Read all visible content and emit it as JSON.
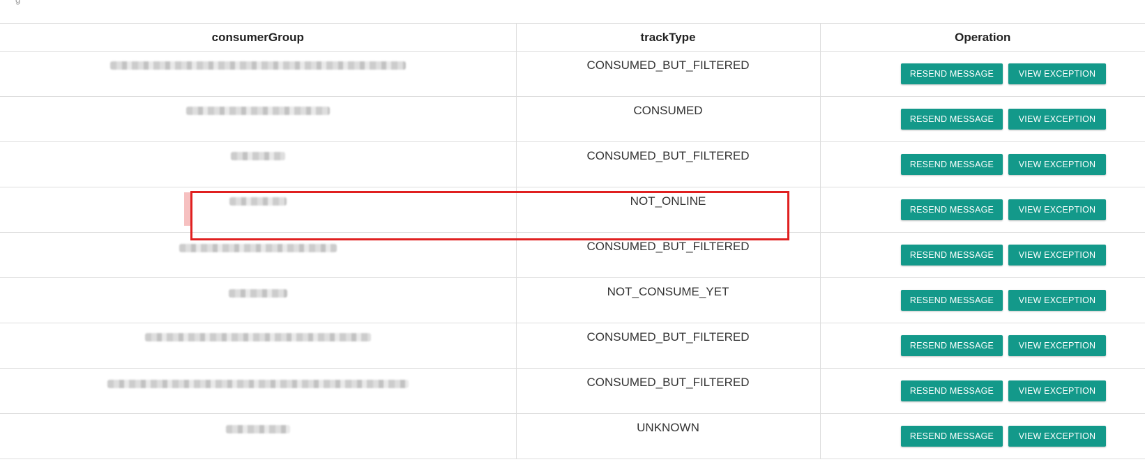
{
  "top_fragment": "g",
  "table": {
    "headers": {
      "consumer_group": "consumerGroup",
      "track_type": "trackType",
      "operation": "Operation"
    },
    "rows": [
      {
        "consumer_group": "",
        "track_type": "CONSUMED_BUT_FILTERED",
        "resend_label": "RESEND MESSAGE",
        "view_label": "VIEW EXCEPTION"
      },
      {
        "consumer_group": "",
        "track_type": "CONSUMED",
        "resend_label": "RESEND MESSAGE",
        "view_label": "VIEW EXCEPTION"
      },
      {
        "consumer_group": "",
        "track_type": "CONSUMED_BUT_FILTERED",
        "resend_label": "RESEND MESSAGE",
        "view_label": "VIEW EXCEPTION"
      },
      {
        "consumer_group": "",
        "track_type": "NOT_ONLINE",
        "resend_label": "RESEND MESSAGE",
        "view_label": "VIEW EXCEPTION"
      },
      {
        "consumer_group": "",
        "track_type": "CONSUMED_BUT_FILTERED",
        "resend_label": "RESEND MESSAGE",
        "view_label": "VIEW EXCEPTION"
      },
      {
        "consumer_group": "",
        "track_type": "NOT_CONSUME_YET",
        "resend_label": "RESEND MESSAGE",
        "view_label": "VIEW EXCEPTION"
      },
      {
        "consumer_group": "",
        "track_type": "CONSUMED_BUT_FILTERED",
        "resend_label": "RESEND MESSAGE",
        "view_label": "VIEW EXCEPTION"
      },
      {
        "consumer_group": "",
        "track_type": "CONSUMED_BUT_FILTERED",
        "resend_label": "RESEND MESSAGE",
        "view_label": "VIEW EXCEPTION"
      },
      {
        "consumer_group": "",
        "track_type": "UNKNOWN",
        "resend_label": "RESEND MESSAGE",
        "view_label": "VIEW EXCEPTION"
      }
    ]
  },
  "colors": {
    "button_bg": "#13998a",
    "button_text": "#ffffff",
    "highlight_border": "#e02020",
    "table_border": "#dddddd"
  },
  "annotation": {
    "highlighted_row_index": 3
  }
}
